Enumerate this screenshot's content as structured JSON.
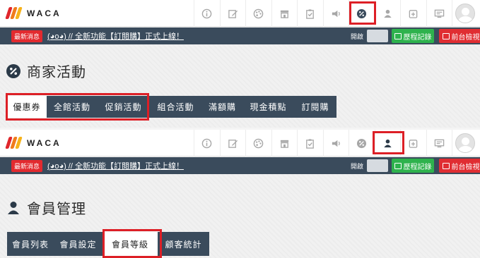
{
  "brand": {
    "logo_text": "WACA"
  },
  "news": {
    "badge": "最新消息",
    "text": "(◕o◕) // 全新功能【訂閱購】正式上線！"
  },
  "controls": {
    "open_label": "開啟",
    "history_button": "歷程記錄",
    "front_button": "前台檢視"
  },
  "toolbar_icons": [
    "info-icon",
    "edit-icon",
    "palette-icon",
    "store-icon",
    "clipboard-check-icon",
    "megaphone-icon",
    "discount-icon",
    "user-icon",
    "add-window-icon",
    "monitor-icon"
  ],
  "panel1": {
    "title": "商家活動",
    "title_icon": "discount-icon",
    "active_toolbar_icon": "discount-icon",
    "tabs": [
      "優惠券",
      "全館活動",
      "促銷活動",
      "組合活動",
      "滿額購",
      "現金積點",
      "訂閱購"
    ],
    "active_tab": "優惠券"
  },
  "panel2": {
    "title": "會員管理",
    "title_icon": "user-icon",
    "active_toolbar_icon": "user-icon",
    "tabs": [
      "會員列表",
      "會員設定",
      "會員等級",
      "顧客統計"
    ],
    "active_tab": "會員等級"
  },
  "colors": {
    "nav_bg": "#3a4b5c",
    "highlight": "#dd1f26",
    "history_button": "#2eb24d",
    "front_button": "#e02d32"
  }
}
